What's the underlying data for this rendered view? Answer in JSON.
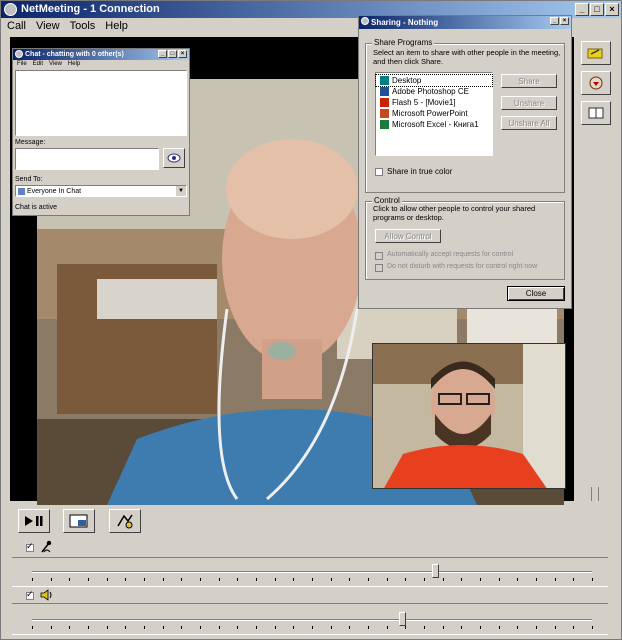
{
  "main": {
    "title": "NetMeeting - 1 Connection",
    "menu": [
      "Call",
      "View",
      "Tools",
      "Help"
    ]
  },
  "chat": {
    "title": "Chat - chatting with 0 other(s)",
    "menu": [
      "File",
      "Edit",
      "View",
      "Help"
    ],
    "message_label": "Message:",
    "send_to_label": "Send To:",
    "send_to_value": "Everyone In Chat",
    "status": "Chat is active"
  },
  "sharing": {
    "title": "Sharing - Nothing",
    "share_programs_legend": "Share Programs",
    "instructions": "Select an item to share with other people in the meeting, and then click Share.",
    "programs": [
      {
        "name": "Desktop",
        "icon": "desktop-icon",
        "color": "#008080"
      },
      {
        "name": "Adobe Photoshop CE",
        "icon": "photoshop-icon",
        "color": "#1f4e9a"
      },
      {
        "name": "Flash 5 - [Movie1]",
        "icon": "flash-icon",
        "color": "#cc2200"
      },
      {
        "name": "Microsoft PowerPoint",
        "icon": "powerpoint-icon",
        "color": "#c8491e"
      },
      {
        "name": "Microsoft Excel - Книга1",
        "icon": "excel-icon",
        "color": "#1d7a3a"
      }
    ],
    "share_button": "Share",
    "unshare_button": "Unshare",
    "unshare_all_button": "Unshare All",
    "true_color_label": "Share in true color",
    "control_legend": "Control",
    "control_instructions": "Click to allow other people to control your shared programs or desktop.",
    "allow_control_button": "Allow Control",
    "auto_accept_label": "Automatically accept requests for control",
    "do_not_disturb_label": "Do not disturb with requests for control right now",
    "close_button": "Close"
  },
  "controls": {
    "mic_checked": true,
    "speaker_checked": true,
    "mic_level": 0.72,
    "speaker_level": 0.66,
    "accent": "#1a9a1a"
  }
}
